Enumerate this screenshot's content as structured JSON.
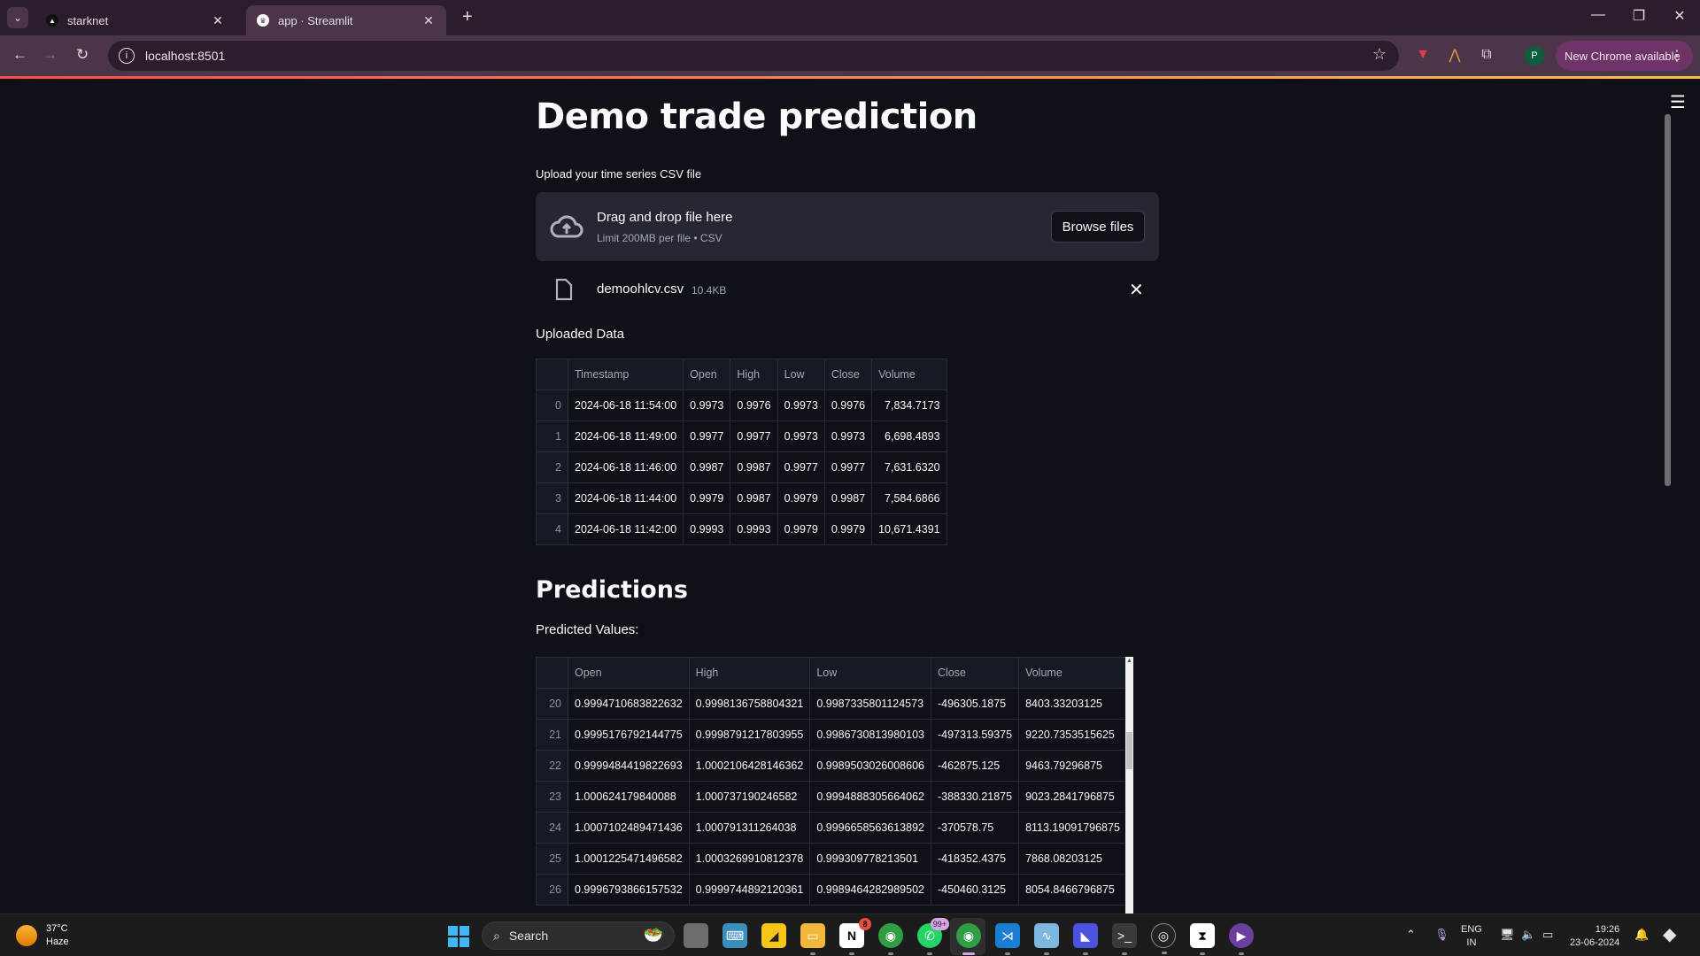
{
  "browser": {
    "tabs": [
      {
        "label": "starknet",
        "favicon": "starknet-icon",
        "active": false
      },
      {
        "label": "app · Streamlit",
        "favicon": "streamlit-icon",
        "active": true
      }
    ],
    "url": "localhost:8501",
    "profile_initial": "P",
    "update_button": "New Chrome available"
  },
  "app": {
    "title": "Demo trade prediction",
    "uploader": {
      "label": "Upload your time series CSV file",
      "drop_text": "Drag and drop file here",
      "limit_text": "Limit 200MB per file • CSV",
      "browse_label": "Browse files",
      "file": {
        "name": "demoohlcv.csv",
        "size": "10.4KB"
      }
    },
    "uploaded": {
      "label": "Uploaded Data",
      "columns": [
        "",
        "Timestamp",
        "Open",
        "High",
        "Low",
        "Close",
        "Volume"
      ],
      "rows": [
        [
          "0",
          "2024-06-18 11:54:00",
          "0.9973",
          "0.9976",
          "0.9973",
          "0.9976",
          "7,834.7173"
        ],
        [
          "1",
          "2024-06-18 11:49:00",
          "0.9977",
          "0.9977",
          "0.9973",
          "0.9973",
          "6,698.4893"
        ],
        [
          "2",
          "2024-06-18 11:46:00",
          "0.9987",
          "0.9987",
          "0.9977",
          "0.9977",
          "7,631.6320"
        ],
        [
          "3",
          "2024-06-18 11:44:00",
          "0.9979",
          "0.9987",
          "0.9979",
          "0.9987",
          "7,584.6866"
        ],
        [
          "4",
          "2024-06-18 11:42:00",
          "0.9993",
          "0.9993",
          "0.9979",
          "0.9979",
          "10,671.4391"
        ]
      ]
    },
    "predictions": {
      "heading": "Predictions",
      "label": "Predicted Values:",
      "columns": [
        "",
        "Open",
        "High",
        "Low",
        "Close",
        "Volume"
      ],
      "rows": [
        [
          "20",
          "0.9994710683822632",
          "0.9998136758804321",
          "0.9987335801124573",
          "-496305.1875",
          "8403.33203125"
        ],
        [
          "21",
          "0.9995176792144775",
          "0.9998791217803955",
          "0.9986730813980103",
          "-497313.59375",
          "9220.7353515625"
        ],
        [
          "22",
          "0.9999484419822693",
          "1.0002106428146362",
          "0.9989503026008606",
          "-462875.125",
          "9463.79296875"
        ],
        [
          "23",
          "1.000624179840088",
          "1.000737190246582",
          "0.9994888305664062",
          "-388330.21875",
          "9023.2841796875"
        ],
        [
          "24",
          "1.0007102489471436",
          "1.000791311264038",
          "0.9996658563613892",
          "-370578.75",
          "8113.19091796875"
        ],
        [
          "25",
          "1.0001225471496582",
          "1.0003269910812378",
          "0.999309778213501",
          "-418352.4375",
          "7868.08203125"
        ],
        [
          "26",
          "0.9996793866157532",
          "0.9999744892120361",
          "0.9989464282989502",
          "-450460.3125",
          "8054.8466796875"
        ]
      ]
    }
  },
  "taskbar": {
    "weather": {
      "temp": "37°C",
      "condition": "Haze"
    },
    "search_placeholder": "Search",
    "whatsapp_badge": "99+",
    "notion_badge": "8",
    "lang": {
      "line1": "ENG",
      "line2": "IN"
    },
    "time": "19:26",
    "date": "23-06-2024"
  },
  "colors": {
    "app_bg": "#0e1117",
    "dropzone_bg": "#262730",
    "chrome_frame": "#2b1d2b",
    "chrome_toolbar": "#4a3648",
    "accent_gradient_start": "#ff4b4b",
    "accent_gradient_end": "#ffbd45"
  }
}
